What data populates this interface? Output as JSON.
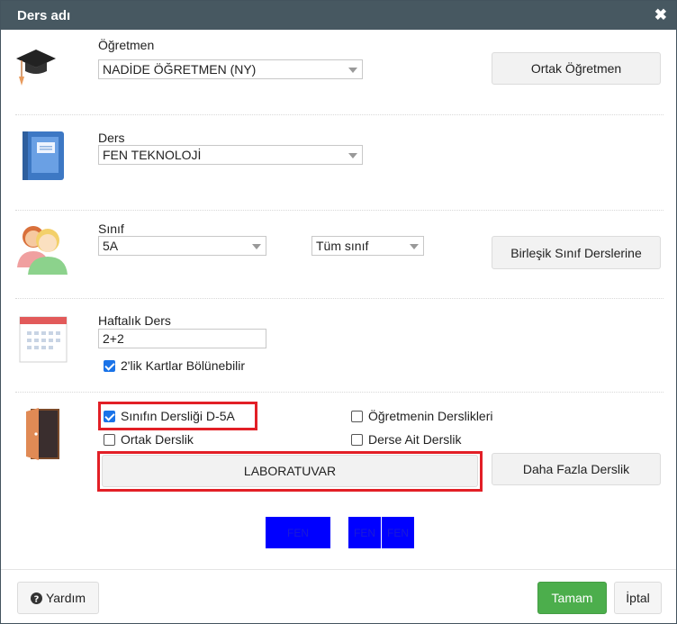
{
  "window": {
    "title": "Ders adı",
    "close_label": "✖"
  },
  "teacher": {
    "label": "Öğretmen",
    "value": "NADİDE ÖĞRETMEN (NY)",
    "button": "Ortak Öğretmen"
  },
  "course": {
    "label": "Ders",
    "value": "FEN TEKNOLOJİ"
  },
  "class": {
    "label": "Sınıf",
    "value": "5A",
    "group": "Tüm sınıf",
    "button": "Birleşik Sınıf Derslerine"
  },
  "weekly": {
    "label": "Haftalık Ders",
    "value": "2+2",
    "split_label": "2'lik Kartlar Bölünebilir",
    "split_checked": true
  },
  "rooms": {
    "class_room_label": "Sınıfın Dersliği D-5A",
    "class_room_checked": true,
    "teacher_rooms_label": "Öğretmenin Derslikleri",
    "teacher_rooms_checked": false,
    "shared_room_label": "Ortak Derslik",
    "shared_room_checked": false,
    "course_room_label": "Derse Ait Derslik",
    "course_room_checked": false,
    "selected_room": "LABORATUVAR",
    "more_button": "Daha Fazla Derslik"
  },
  "cards": [
    "FEN",
    "FEN",
    "FEN"
  ],
  "footer": {
    "help": "Yardım",
    "ok": "Tamam",
    "cancel": "İptal"
  },
  "colors": {
    "titlebar": "#475861",
    "ok_button": "#4cae4c",
    "highlight": "#e21f26",
    "card": "#0000ff"
  }
}
